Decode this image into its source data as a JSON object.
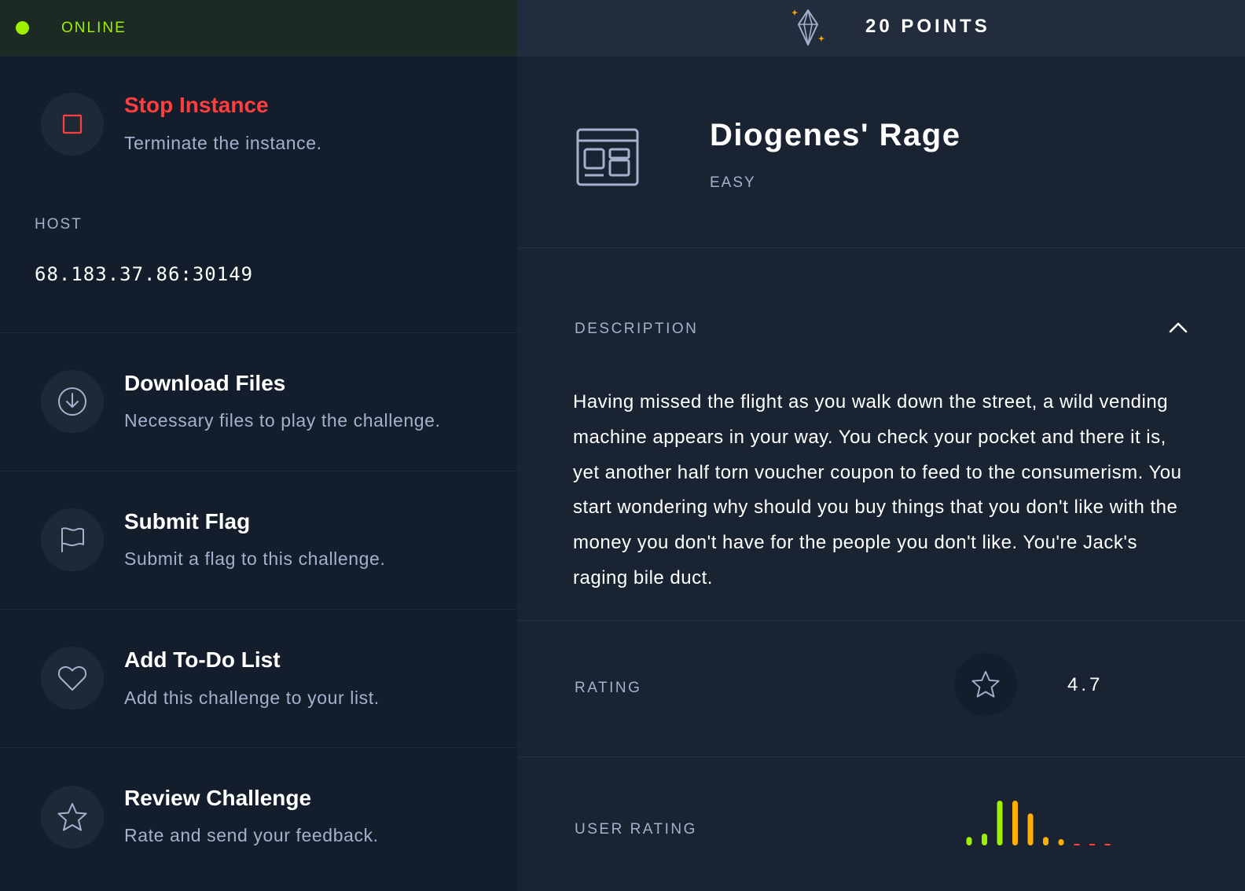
{
  "status": {
    "label": "ONLINE"
  },
  "actions": {
    "stop": {
      "title": "Stop Instance",
      "subtitle": "Terminate the instance."
    },
    "download": {
      "title": "Download Files",
      "subtitle": "Necessary files to play the challenge."
    },
    "flag": {
      "title": "Submit Flag",
      "subtitle": "Submit a flag to this challenge."
    },
    "todo": {
      "title": "Add To-Do List",
      "subtitle": "Add this challenge to your list."
    },
    "review": {
      "title": "Review Challenge",
      "subtitle": "Rate and send your feedback."
    }
  },
  "host": {
    "label": "HOST",
    "value": "68.183.37.86:30149"
  },
  "points": {
    "label": "20 POINTS"
  },
  "challenge": {
    "name": "Diogenes' Rage",
    "difficulty": "EASY"
  },
  "description": {
    "label": "DESCRIPTION",
    "text": "Having missed the flight as you walk down the street, a wild vending machine appears in your way. You check your pocket and there it is, yet another half torn voucher coupon to feed to the consumerism. You start wondering why should you buy things that you don't like with the money you don't have for the people you don't like. You're Jack's raging bile duct."
  },
  "rating": {
    "label": "RATING",
    "value": "4.7"
  },
  "user_rating": {
    "label": "USER RATING",
    "levels": [
      0.18,
      0.25,
      0.95,
      0.95,
      0.68,
      0.18,
      0.12,
      0.0,
      0.0,
      0.0
    ],
    "colors": [
      "#9fef00",
      "#9fef00",
      "#9fef00",
      "#ffaf00",
      "#ffaf00",
      "#ffaf00",
      "#ffaf00",
      "#ff3e3e",
      "#ff3e3e",
      "#ff3e3e"
    ]
  },
  "colors": {
    "accent": "#9fef00",
    "stop": "#ff3e3e",
    "muted": "#a4b1cd"
  }
}
